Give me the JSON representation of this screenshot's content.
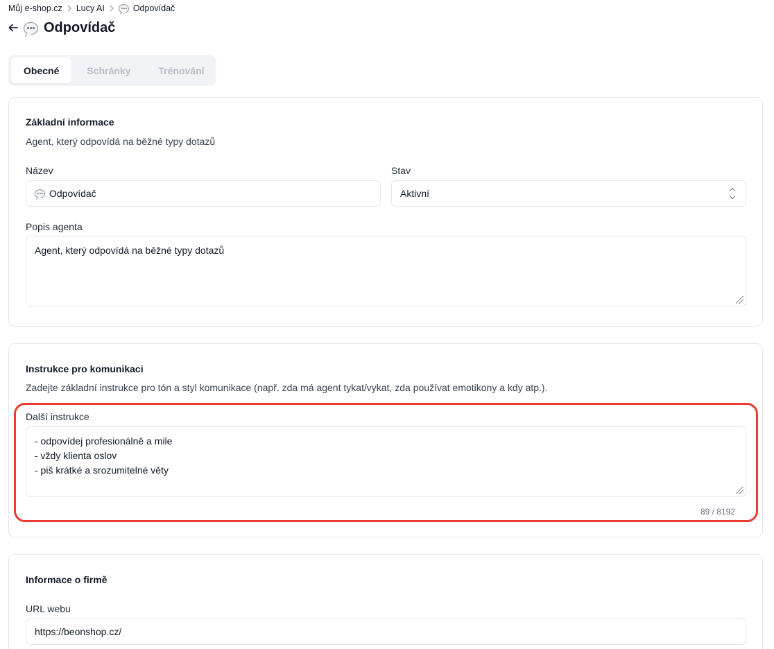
{
  "breadcrumb": {
    "items": [
      "Můj e-shop.cz",
      "Lucy AI",
      "Odpovídač"
    ],
    "separator_icon": "chevron-right-icon"
  },
  "header": {
    "back_icon": "arrow-left-icon",
    "title_icon": "speech-bubble-icon",
    "title": "Odpovídač"
  },
  "tabs": [
    {
      "label": "Obecné",
      "active": true
    },
    {
      "label": "Schránky",
      "active": false
    },
    {
      "label": "Trénování",
      "active": false
    }
  ],
  "basic_info": {
    "title": "Základní informace",
    "description": "Agent, který odpovídá na běžné typy dotazů",
    "name_label": "Název",
    "name_value": "Odpovídač",
    "status_label": "Stav",
    "status_value": "Aktivní",
    "agent_desc_label": "Popis agenta",
    "agent_desc_value": "Agent, který odpovídá na běžné typy dotazů"
  },
  "instructions": {
    "title": "Instrukce pro komunikaci",
    "description": "Zadejte základní instrukce pro tón a styl komunikace (např. zda má agent tykat/vykat, zda používat emotikony a kdy atp.).",
    "field_label": "Další instrukce",
    "lines": [
      "- odpovídej profesionálně a mile",
      "- vždy klienta oslov",
      "- piš krátké a srozumitelné věty"
    ],
    "counter": "89 / 8192"
  },
  "company": {
    "title": "Informace o firmě",
    "url_label": "URL webu",
    "url_value": "https://beonshop.cz/"
  },
  "colors": {
    "highlight": "#ee3b30",
    "tab_bg": "#f1f3f6",
    "border": "#e5e7eb"
  }
}
